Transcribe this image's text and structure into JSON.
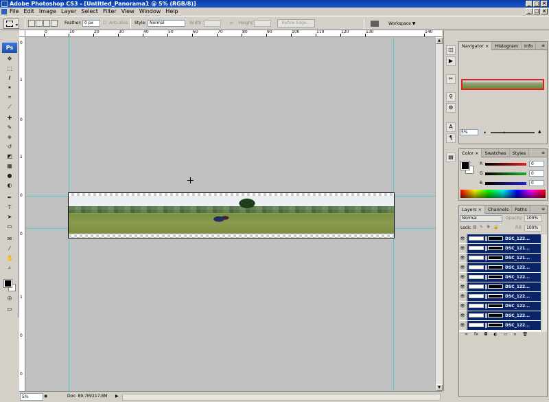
{
  "window": {
    "title": "Adobe Photoshop CS3 - [Untitled_Panorama1 @ 5% (RGB/8)]",
    "min_label": "_",
    "max_label": "□",
    "close_label": "×"
  },
  "menu": {
    "items": [
      "File",
      "Edit",
      "Image",
      "Layer",
      "Select",
      "Filter",
      "View",
      "Window",
      "Help"
    ]
  },
  "options": {
    "feather_label": "Feather:",
    "feather_value": "0 px",
    "antialias_label": "Anti-alias",
    "style_label": "Style:",
    "style_value": "Normal",
    "width_label": "Width:",
    "height_label": "Height:",
    "refine_edge_label": "Refine Edge...",
    "workspace_label": "Workspace ▼"
  },
  "toolbox": {
    "logo": "Ps",
    "tools": [
      "move-tool-icon",
      "marquee-tool-icon",
      "lasso-tool-icon",
      "magic-wand-tool-icon",
      "crop-tool-icon",
      "slice-tool-icon",
      "healing-brush-tool-icon",
      "brush-tool-icon",
      "clone-stamp-tool-icon",
      "history-brush-tool-icon",
      "eraser-tool-icon",
      "gradient-tool-icon",
      "blur-tool-icon",
      "dodge-tool-icon",
      "pen-tool-icon",
      "type-tool-icon",
      "path-selection-tool-icon",
      "rectangle-tool-icon",
      "notes-tool-icon",
      "eyedropper-tool-icon",
      "hand-tool-icon",
      "zoom-tool-icon"
    ],
    "glyphs": [
      "✥",
      "⬚",
      "ℓ",
      "✶",
      "⌗",
      "⟋",
      "✚",
      "✎",
      "⎈",
      "↺",
      "◩",
      "▦",
      "●",
      "◐",
      "✒",
      "T",
      "➤",
      "▭",
      "✉",
      "⁄",
      "✋",
      "⌕"
    ]
  },
  "rulers": {
    "h_labels": [
      "0",
      "10",
      "20",
      "30",
      "40",
      "50",
      "60",
      "70",
      "80",
      "90",
      "100",
      "110",
      "120",
      "130",
      "140"
    ],
    "v_labels": [
      "0",
      "1",
      "0",
      "1",
      "0",
      "0",
      "1",
      "0",
      "0"
    ]
  },
  "status": {
    "zoom": "5%",
    "doc_info": "Doc: 89.7M/217.8M"
  },
  "dock_icons": [
    "navigator-dock-icon",
    "info-dock-icon",
    "tools-dock-icon",
    "clone-source-dock-icon",
    "actions-dock-icon",
    "character-dock-icon",
    "paragraph-dock-icon",
    "layer-comps-dock-icon"
  ],
  "dock_glyphs": [
    "◫",
    "▶",
    "✂",
    "⚲",
    "⚙",
    "A",
    "¶",
    "▤"
  ],
  "navigator": {
    "tabs": [
      "Navigator ×",
      "Histogram",
      "Info"
    ],
    "zoom": "5%"
  },
  "color_panel": {
    "tabs": [
      "Color ×",
      "Swatches",
      "Styles"
    ],
    "r_label": "R",
    "g_label": "G",
    "b_label": "B",
    "r_value": "0",
    "g_value": "0",
    "b_value": "0",
    "r_color": "#e02020",
    "g_color": "#20b020",
    "b_color": "#2020e0"
  },
  "layers_panel": {
    "tabs": [
      "Layers ×",
      "Channels",
      "Paths"
    ],
    "blend_mode": "Normal",
    "opacity_label": "Opacity:",
    "opacity_value": "100%",
    "lock_label": "Lock:",
    "fill_label": "Fill:",
    "fill_value": "100%",
    "selected_color": "#0a246a",
    "layers": [
      {
        "name": "DSC_122..."
      },
      {
        "name": "DSC_121..."
      },
      {
        "name": "DSC_121..."
      },
      {
        "name": "DSC_122..."
      },
      {
        "name": "DSC_122..."
      },
      {
        "name": "DSC_122..."
      },
      {
        "name": "DSC_122..."
      },
      {
        "name": "DSC_122..."
      },
      {
        "name": "DSC_122..."
      },
      {
        "name": "DSC_122..."
      }
    ],
    "footer_icons": [
      "link-layers-icon",
      "fx-icon",
      "add-mask-icon",
      "adjustment-layer-icon",
      "new-group-icon",
      "new-layer-icon",
      "trash-icon"
    ],
    "footer_glyphs": [
      "∞",
      "fx",
      "◘",
      "◐",
      "▭",
      "▫",
      "🗑"
    ]
  }
}
